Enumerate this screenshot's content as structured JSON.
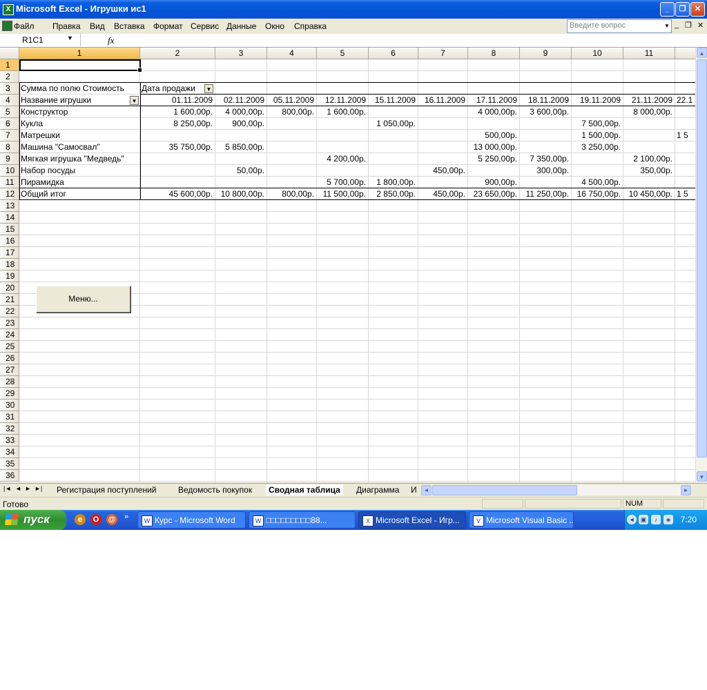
{
  "window": {
    "title": "Microsoft Excel - Игрушки ис1",
    "min_glyph": "_",
    "max_glyph": "❐",
    "close_glyph": "✕",
    "app_icon_glyph": "X"
  },
  "menu": [
    "Файл",
    "Правка",
    "Вид",
    "Вставка",
    "Формат",
    "Сервис",
    "Данные",
    "Окно",
    "Справка"
  ],
  "ask_box": {
    "placeholder": "Введите вопрос"
  },
  "mdi_buttons": [
    "_",
    "❐",
    "✕"
  ],
  "formula_bar": {
    "name_box": "R1C1",
    "fx_label": "fx",
    "value": ""
  },
  "columns": [
    "1",
    "2",
    "3",
    "4",
    "5",
    "6",
    "7",
    "8",
    "9",
    "10",
    "11",
    ""
  ],
  "rows": [
    "1",
    "2",
    "3",
    "4",
    "5",
    "6",
    "7",
    "8",
    "9",
    "10",
    "11",
    "12",
    "13",
    "14",
    "15",
    "16",
    "17",
    "18",
    "19",
    "20",
    "21",
    "22",
    "23",
    "24",
    "25",
    "26",
    "27",
    "28",
    "29",
    "30",
    "31",
    "32",
    "33",
    "34",
    "35",
    "36"
  ],
  "pivot": {
    "data_field_label": "Сумма по полю Стоимость",
    "column_field_label": "Дата продажи",
    "row_field_label": "Название игрушки",
    "dates": [
      "01.11.2009",
      "02.11.2009",
      "05.11.2009",
      "12.11.2009",
      "15.11.2009",
      "16.11.2009",
      "17.11.2009",
      "18.11.2009",
      "19.11.2009",
      "21.11.2009",
      "22.1"
    ],
    "rows": [
      {
        "name": "Конструктор",
        "values": [
          "1 600,00р.",
          "4 000,00р.",
          "800,00р.",
          "1 600,00р.",
          "",
          "",
          "4 000,00р.",
          "3 600,00р.",
          "",
          "8 000,00р.",
          ""
        ]
      },
      {
        "name": "Кукла",
        "values": [
          "8 250,00р.",
          "900,00р.",
          "",
          "",
          "1 050,00р.",
          "",
          "",
          "",
          "7 500,00р.",
          "",
          ""
        ]
      },
      {
        "name": "Матрешки",
        "values": [
          "",
          "",
          "",
          "",
          "",
          "",
          "500,00р.",
          "",
          "1 500,00р.",
          "",
          "1 5"
        ]
      },
      {
        "name": "Машина \"Самосвал\"",
        "values": [
          "35 750,00р.",
          "5 850,00р.",
          "",
          "",
          "",
          "",
          "13 000,00р.",
          "",
          "3 250,00р.",
          "",
          ""
        ]
      },
      {
        "name": "Мягкая игрушка \"Медведь\"",
        "values": [
          "",
          "",
          "",
          "4 200,00р.",
          "",
          "",
          "5 250,00р.",
          "7 350,00р.",
          "",
          "2 100,00р.",
          ""
        ]
      },
      {
        "name": "Набор посуды",
        "values": [
          "",
          "50,00р.",
          "",
          "",
          "",
          "450,00р.",
          "",
          "300,00р.",
          "",
          "350,00р.",
          ""
        ]
      },
      {
        "name": "Пирамидка",
        "values": [
          "",
          "",
          "",
          "5 700,00р.",
          "1 800,00р.",
          "",
          "900,00р.",
          "",
          "4 500,00р.",
          "",
          ""
        ]
      }
    ],
    "total": {
      "name": "Общий итог",
      "values": [
        "45 600,00р.",
        "10 800,00р.",
        "800,00р.",
        "11 500,00р.",
        "2 850,00р.",
        "450,00р.",
        "23 650,00р.",
        "11 250,00р.",
        "16 750,00р.",
        "10 450,00р.",
        "1 5"
      ]
    }
  },
  "menu_button": "Меню...",
  "sheet_tabs": [
    "Регистрация поступлений",
    "Ведомость покупок",
    "Сводная таблица",
    "Диаграмма",
    "И"
  ],
  "active_sheet": "Сводная таблица",
  "tab_nav": [
    "|◄",
    "◄",
    "►",
    "►|"
  ],
  "status": {
    "text": "Готово",
    "num": "NUM"
  },
  "taskbar": {
    "start": "пуск",
    "quick_launch_more": "»",
    "tasks": [
      "Курс - Microsoft Word",
      "□□□□□□□□□88...",
      "Microsoft Excel - Игр...",
      "Microsoft Visual Basic ..."
    ],
    "clock": "7:20"
  },
  "colors": {
    "titlebar": "#0453d6",
    "taskbar": "#245ddb",
    "start": "#3aa03a",
    "selected_header": "#f6b848",
    "face": "#ece9d8"
  }
}
